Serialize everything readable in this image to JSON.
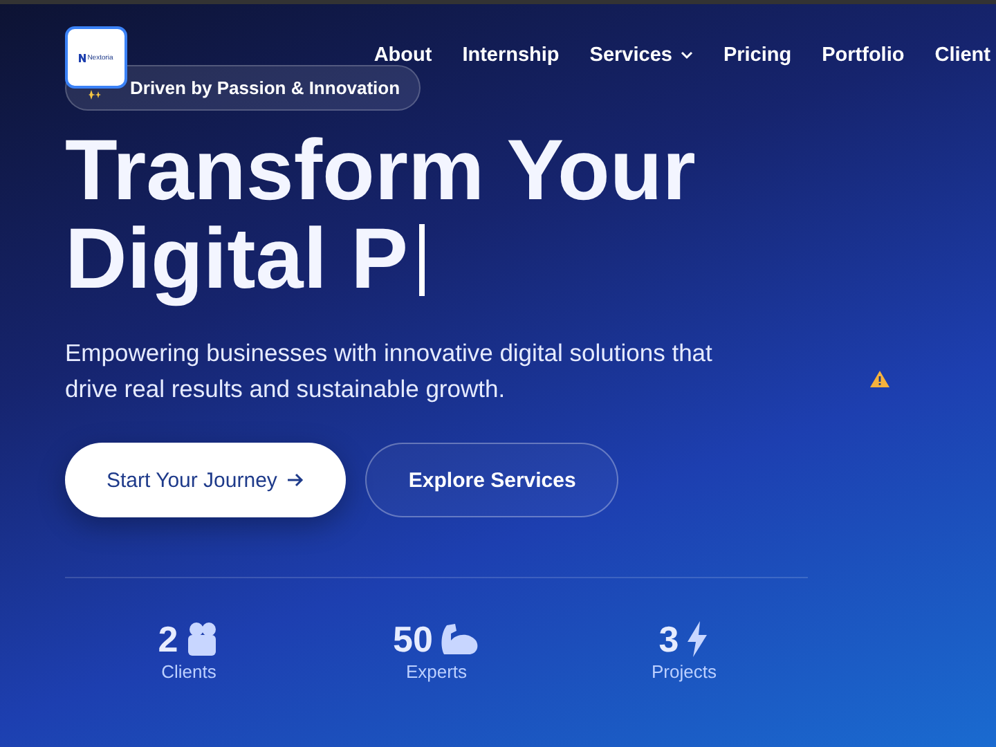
{
  "logo": {
    "text": "Nextoria"
  },
  "nav": [
    {
      "label": "About",
      "kind": "link"
    },
    {
      "label": "Internship",
      "kind": "link"
    },
    {
      "label": "Services",
      "kind": "dropdown"
    },
    {
      "label": "Pricing",
      "kind": "link"
    },
    {
      "label": "Portfolio",
      "kind": "link"
    },
    {
      "label": "Client",
      "kind": "link"
    }
  ],
  "badge": {
    "text": "Driven by Passion & Innovation"
  },
  "hero": {
    "title_lines": [
      "Transform Your",
      "Digital P"
    ],
    "subtitle": "Empowering businesses with innovative digital solutions that drive real results and sustainable growth."
  },
  "buttons": [
    {
      "label": "Start Your Journey",
      "kind": "primary"
    },
    {
      "label": "Explore Services",
      "kind": "outline"
    }
  ],
  "stats": [
    {
      "value": "2",
      "label": "Clients",
      "kind": "people"
    },
    {
      "value": "50",
      "label": "Experts",
      "kind": "muscle"
    },
    {
      "value": "3",
      "label": "Projects",
      "kind": "bolt"
    }
  ]
}
